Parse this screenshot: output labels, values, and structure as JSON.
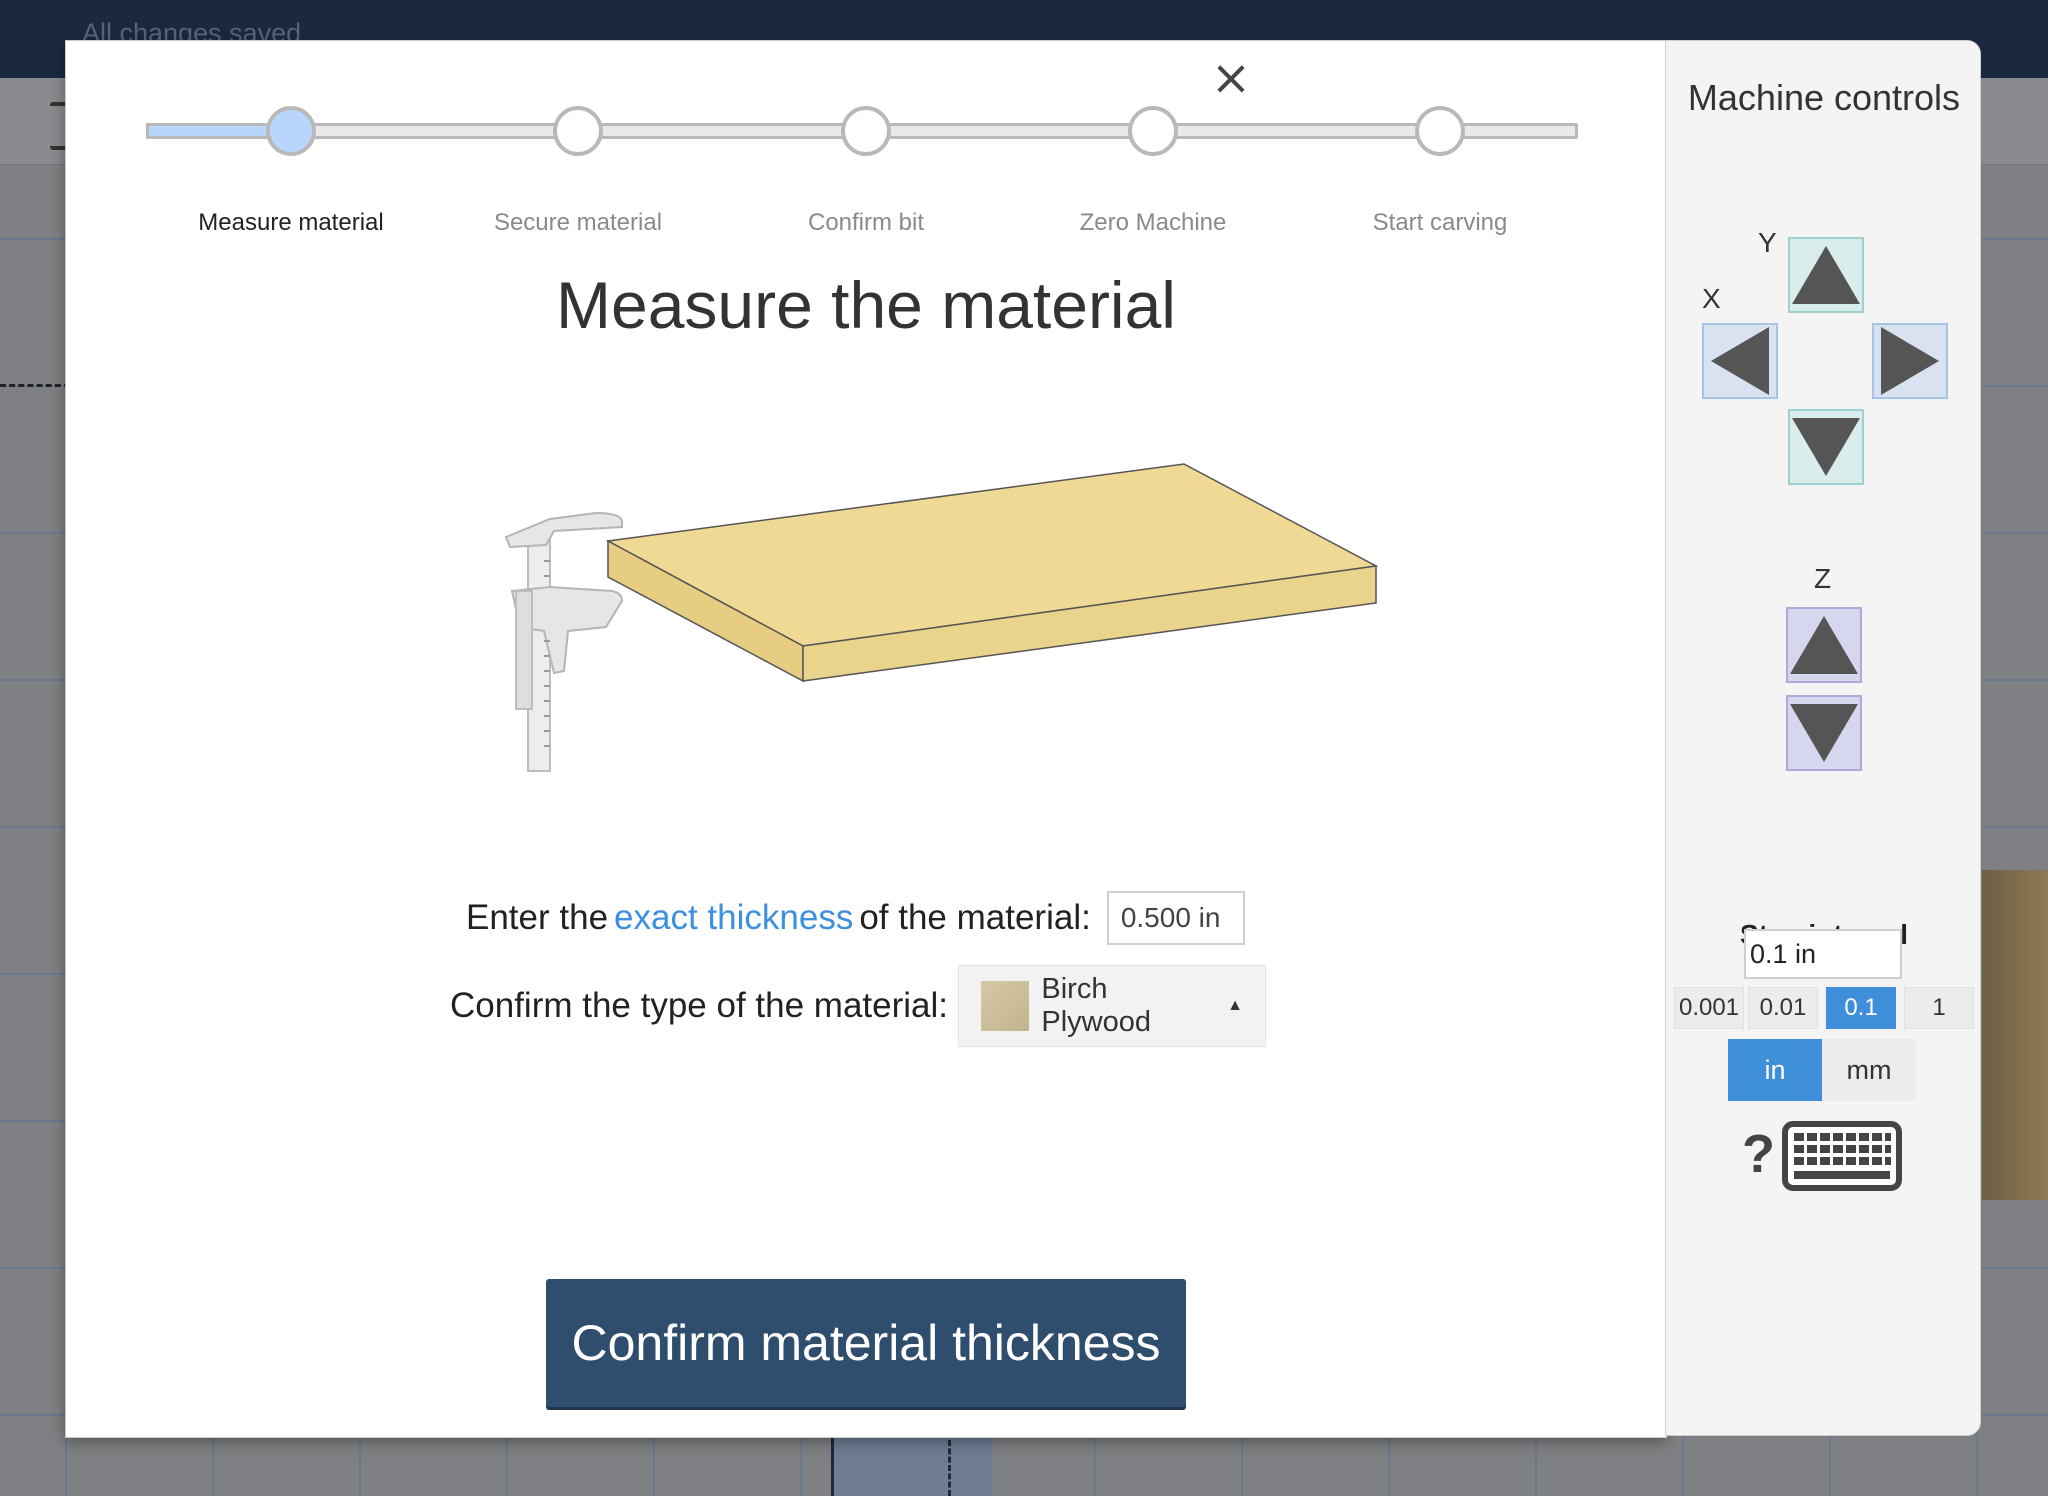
{
  "app": {
    "save_status": "All changes saved"
  },
  "wizard": {
    "close_symbol": "×",
    "steps": [
      {
        "label": "Measure material",
        "active": true
      },
      {
        "label": "Secure material",
        "active": false
      },
      {
        "label": "Confirm bit",
        "active": false
      },
      {
        "label": "Zero Machine",
        "active": false
      },
      {
        "label": "Start carving",
        "active": false
      }
    ],
    "title": "Measure the material",
    "thickness_prompt_before": "Enter the",
    "thickness_prompt_link": "exact thickness",
    "thickness_prompt_after": "of the material:",
    "thickness_value": "0.500 in",
    "type_prompt": "Confirm the type of the material:",
    "material_type": "Birch Plywood",
    "confirm_button": "Confirm material thickness"
  },
  "machine_controls": {
    "title": "Machine controls",
    "axis_y": "Y",
    "axis_x": "X",
    "axis_z": "Z",
    "step_interval_title": "Step interval",
    "step_interval_value": "0.1 in",
    "intervals": [
      "0.001",
      "0.01",
      "0.1",
      "1"
    ],
    "selected_interval": "0.1",
    "units": [
      "in",
      "mm"
    ],
    "selected_unit": "in",
    "help_symbol": "?"
  },
  "colors": {
    "primary_button": "#2f4d6c",
    "accent_blue": "#3f8ed9",
    "progress_fill": "#b8d6fb",
    "link": "#3d8fe0",
    "board": "#efd994"
  }
}
